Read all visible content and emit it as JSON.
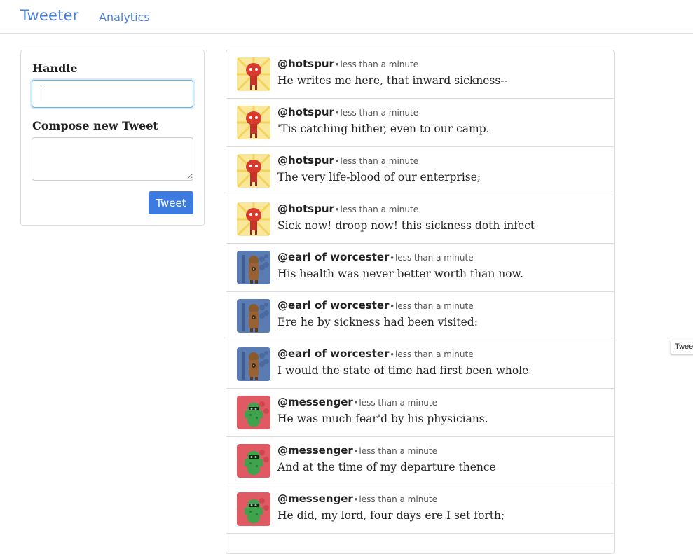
{
  "navbar": {
    "brand": "Tweeter",
    "analytics_link": "Analytics"
  },
  "compose": {
    "handle_label": "Handle",
    "handle_value": "",
    "compose_label": "Compose new Tweet",
    "tweet_value": "",
    "tweet_button": "Tweet"
  },
  "feed": {
    "tweets": [
      {
        "handle": "@hotspur",
        "separator": "•",
        "time": "less than a minute",
        "text": "He writes me here, that inward sickness--",
        "avatar": "hotspur-avatar-icon"
      },
      {
        "handle": "@hotspur",
        "separator": "•",
        "time": "less than a minute",
        "text": "'Tis catching hither, even to our camp.",
        "avatar": "hotspur-avatar-icon"
      },
      {
        "handle": "@hotspur",
        "separator": "•",
        "time": "less than a minute",
        "text": "The very life-blood of our enterprise;",
        "avatar": "hotspur-avatar-icon"
      },
      {
        "handle": "@hotspur",
        "separator": "•",
        "time": "less than a minute",
        "text": "Sick now! droop now! this sickness doth infect",
        "avatar": "hotspur-avatar-icon"
      },
      {
        "handle": "@earl of worcester",
        "separator": "•",
        "time": "less than a minute",
        "text": "His health was never better worth than now.",
        "avatar": "worcester-avatar-icon"
      },
      {
        "handle": "@earl of worcester",
        "separator": "•",
        "time": "less than a minute",
        "text": "Ere he by sickness had been visited:",
        "avatar": "worcester-avatar-icon"
      },
      {
        "handle": "@earl of worcester",
        "separator": "•",
        "time": "less than a minute",
        "text": "I would the state of time had first been whole",
        "avatar": "worcester-avatar-icon"
      },
      {
        "handle": "@messenger",
        "separator": "•",
        "time": "less than a minute",
        "text": "He was much fear'd by his physicians.",
        "avatar": "messenger-avatar-icon"
      },
      {
        "handle": "@messenger",
        "separator": "•",
        "time": "less than a minute",
        "text": "And at the time of my departure thence",
        "avatar": "messenger-avatar-icon"
      },
      {
        "handle": "@messenger",
        "separator": "•",
        "time": "less than a minute",
        "text": "He did, my lord, four days ere I set forth;",
        "avatar": "messenger-avatar-icon"
      }
    ]
  },
  "tooltip": {
    "text": "Twee"
  },
  "colors": {
    "link": "#4a7fd6",
    "button": "#3e7be0",
    "focus": "#66afe9"
  }
}
